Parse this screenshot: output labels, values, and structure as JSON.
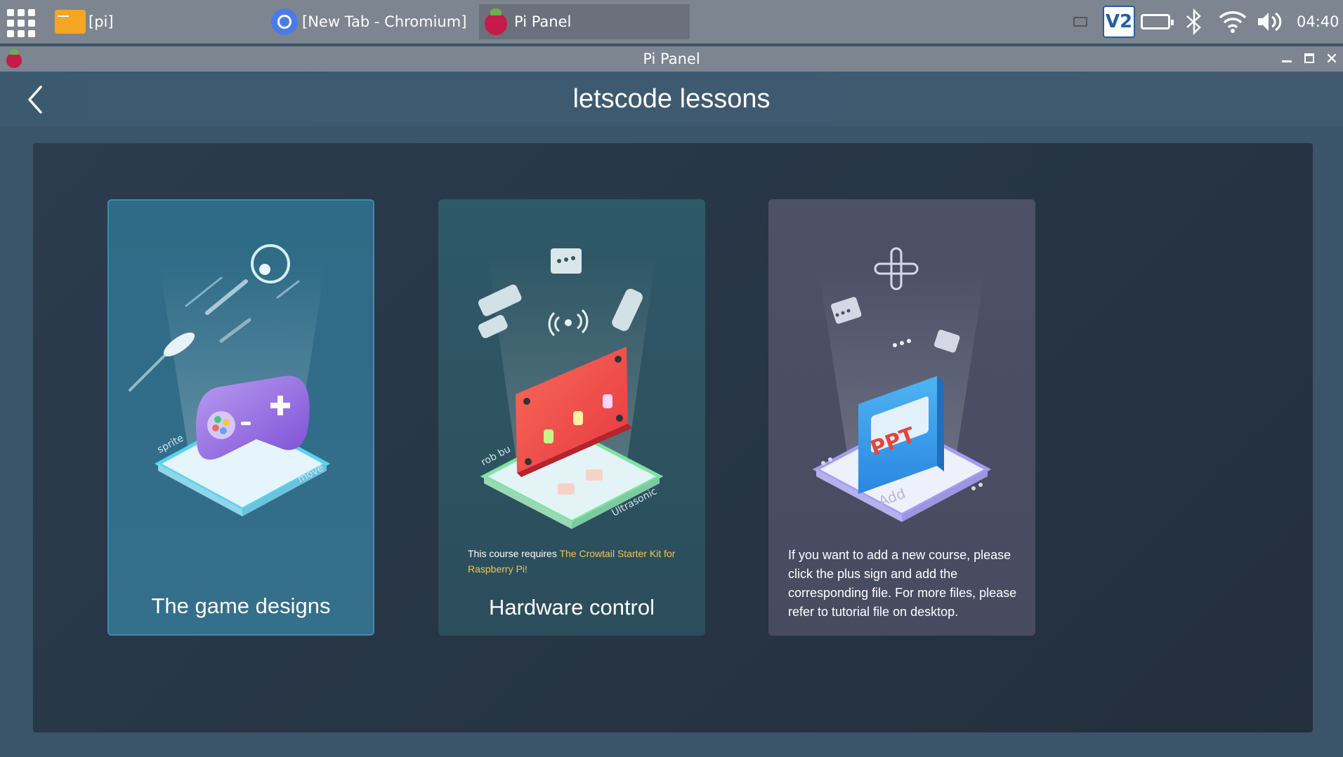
{
  "taskbar": {
    "tasks": [
      {
        "label": "[pi]"
      },
      {
        "label": "[New Tab - Chromium]"
      },
      {
        "label": "Pi Panel"
      }
    ],
    "vnc_label": "V2",
    "clock": "04:40"
  },
  "window": {
    "title": "Pi Panel"
  },
  "app": {
    "title": "letscode lessons",
    "cards": [
      {
        "label": "The game designs",
        "tags": [
          "sprite",
          "move"
        ]
      },
      {
        "label": "Hardware control",
        "tags": [
          "rob bu",
          "Ultrasonic"
        ],
        "note_prefix": "This course requires ",
        "note_link": "The Crowtail Starter Kit for Raspberry Pi!"
      },
      {
        "description": "If you want to add a new course, please click the plus sign and add the corresponding file. For more files, please refer to tutorial file on desktop.",
        "badge": "PPT",
        "tag": "Add"
      }
    ]
  },
  "colors": {
    "accent_yellow": "#f3c451",
    "taskbar": "#7d8590"
  }
}
